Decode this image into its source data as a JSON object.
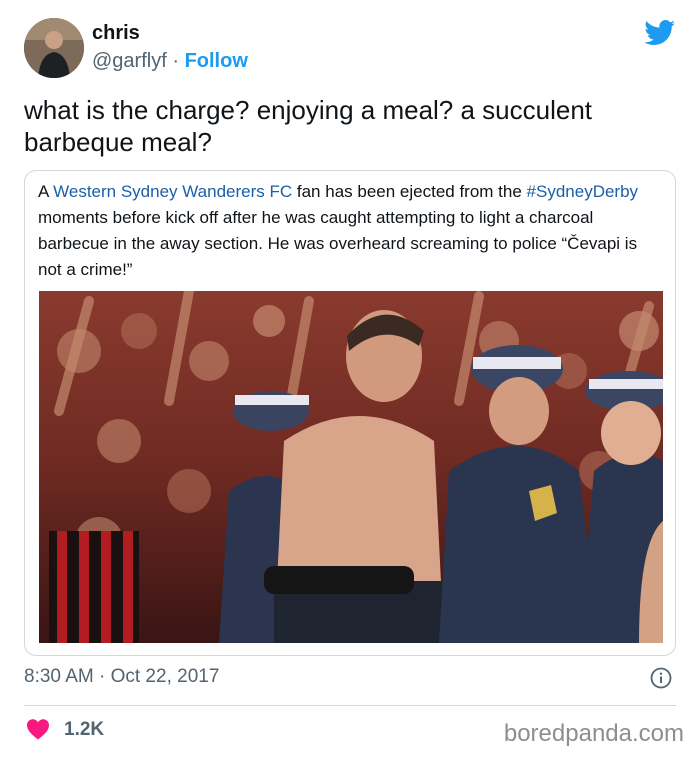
{
  "author": {
    "name": "chris",
    "handle": "@garflyf",
    "separator": "·",
    "follow_label": "Follow"
  },
  "tweet": {
    "text": "what is the charge? enjoying a meal? a succulent barbeque meal?"
  },
  "quoted": {
    "prefix": "A ",
    "link1": "Western Sydney Wanderers FC",
    "mid1": " fan has been ejected from the ",
    "link2": "#SydneyDerby",
    "rest": " moments before kick off after he was caught attempting to light a charcoal barbecue in the away section. He was overheard screaming to police “Čevapi is not a crime!”"
  },
  "timestamp": "8:30 AM · Oct 22, 2017",
  "likes": "1.2K",
  "watermark": "boredpanda.com",
  "icons": {
    "brand": "twitter-bird-icon",
    "info": "info-icon",
    "like": "heart-icon"
  },
  "colors": {
    "accent": "#1d9bf0",
    "heart": "#f91880",
    "link": "#1b5fa8",
    "muted": "#536471"
  }
}
